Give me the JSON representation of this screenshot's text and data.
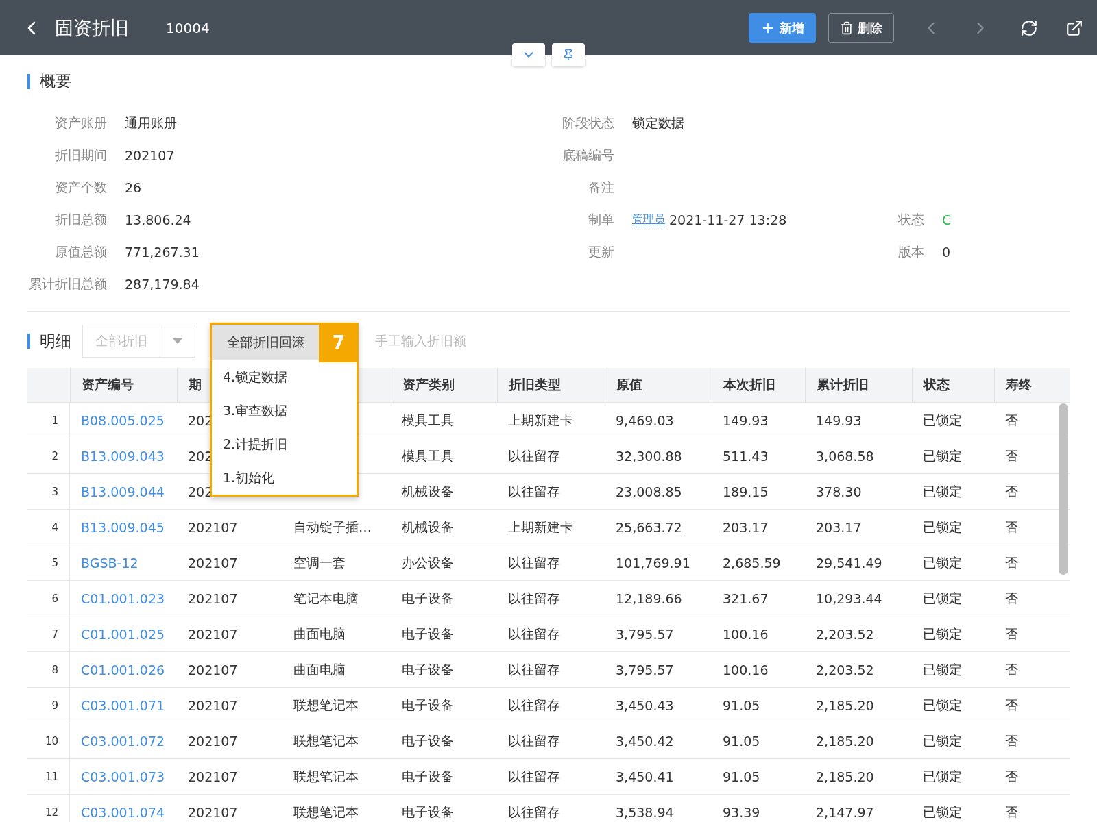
{
  "header": {
    "title": "固资折旧",
    "record_no": "10004",
    "buttons": [
      {
        "kind": "add",
        "label": "新增"
      },
      {
        "kind": "delete",
        "label": "删除"
      }
    ]
  },
  "summary": {
    "title": "概要",
    "rows": [
      {
        "left": {
          "label": "资产账册",
          "value": "通用账册"
        },
        "middle": {
          "label": "阶段状态",
          "value": "锁定数据"
        }
      },
      {
        "left": {
          "label": "折旧期间",
          "value": "202107"
        },
        "middle": {
          "label": "底稿编号"
        }
      },
      {
        "left": {
          "label": "资产个数",
          "value": "26"
        },
        "middle": {
          "label": "备注"
        }
      },
      {
        "left": {
          "label": "折旧总额",
          "value": "13,806.24"
        },
        "middle": {
          "label": "制单",
          "link": "管理员",
          "value": "2021-11-27 13:28"
        },
        "right": {
          "label": "状态",
          "value": "C",
          "color": "#2eb84b"
        }
      },
      {
        "left": {
          "label": "原值总额",
          "value": "771,267.31"
        },
        "middle": {
          "label": "更新"
        },
        "right": {
          "label": "版本",
          "value": "0"
        }
      },
      {
        "left": {
          "label": "累计折旧总额",
          "value": "287,179.84"
        }
      }
    ]
  },
  "detail": {
    "title": "明细",
    "split_button": {
      "label": "全部折旧",
      "disabled": true
    },
    "rollback_button": {
      "label": "全部折旧回滚"
    },
    "manual_button": {
      "label": "手工输入折旧额",
      "disabled": true
    },
    "menu": {
      "items": [
        "4.锁定数据",
        "3.审查数据",
        "2.计提折旧",
        "1.初始化"
      ]
    },
    "step_badge": "7"
  },
  "table": {
    "columns": [
      {
        "label": "资产编号"
      },
      {
        "label": "期"
      },
      {},
      {
        "label": "资产类别"
      },
      {
        "label": "折旧类型"
      },
      {
        "label": "原值"
      },
      {
        "label": "本次折旧"
      },
      {
        "label": "累计折旧"
      },
      {
        "label": "状态"
      },
      {
        "label": "寿终"
      }
    ],
    "rows": [
      {
        "no": "1",
        "cells": [
          "B08.005.025",
          "202",
          null,
          "模具工具",
          "上期新建卡",
          "9,469.03",
          "149.93",
          "149.93",
          "已锁定",
          "否"
        ]
      },
      {
        "no": "2",
        "cells": [
          "B13.009.043",
          "202",
          null,
          "模具工具",
          "以往留存",
          "32,300.88",
          "511.43",
          "3,068.58",
          "已锁定",
          "否"
        ]
      },
      {
        "no": "3",
        "cells": [
          "B13.009.044",
          "202",
          null,
          "机械设备",
          "以往留存",
          "23,008.85",
          "189.15",
          "378.30",
          "已锁定",
          "否"
        ]
      },
      {
        "no": "4",
        "cells": [
          "B13.009.045",
          "202107",
          "自动锭子插…",
          "机械设备",
          "上期新建卡",
          "25,663.72",
          "203.17",
          "203.17",
          "已锁定",
          "否"
        ]
      },
      {
        "no": "5",
        "cells": [
          "BGSB-12",
          "202107",
          "空调一套",
          "办公设备",
          "以往留存",
          "101,769.91",
          "2,685.59",
          "29,541.49",
          "已锁定",
          "否"
        ]
      },
      {
        "no": "6",
        "cells": [
          "C01.001.023",
          "202107",
          "笔记本电脑",
          "电子设备",
          "以往留存",
          "12,189.66",
          "321.67",
          "10,293.44",
          "已锁定",
          "否"
        ]
      },
      {
        "no": "7",
        "cells": [
          "C01.001.025",
          "202107",
          "曲面电脑",
          "电子设备",
          "以往留存",
          "3,795.57",
          "100.16",
          "2,203.52",
          "已锁定",
          "否"
        ]
      },
      {
        "no": "8",
        "cells": [
          "C01.001.026",
          "202107",
          "曲面电脑",
          "电子设备",
          "以往留存",
          "3,795.57",
          "100.16",
          "2,203.52",
          "已锁定",
          "否"
        ]
      },
      {
        "no": "9",
        "cells": [
          "C03.001.071",
          "202107",
          "联想笔记本",
          "电子设备",
          "以往留存",
          "3,450.43",
          "91.05",
          "2,185.20",
          "已锁定",
          "否"
        ]
      },
      {
        "no": "10",
        "cells": [
          "C03.001.072",
          "202107",
          "联想笔记本",
          "电子设备",
          "以往留存",
          "3,450.42",
          "91.05",
          "2,185.20",
          "已锁定",
          "否"
        ]
      },
      {
        "no": "11",
        "cells": [
          "C03.001.073",
          "202107",
          "联想笔记本",
          "电子设备",
          "以往留存",
          "3,450.41",
          "91.05",
          "2,185.20",
          "已锁定",
          "否"
        ]
      },
      {
        "no": "12",
        "cells": [
          "C03.001.074",
          "202107",
          "联想笔记本",
          "电子设备",
          "以往留存",
          "3,538.94",
          "93.39",
          "2,147.97",
          "已锁定",
          "否"
        ]
      }
    ]
  }
}
